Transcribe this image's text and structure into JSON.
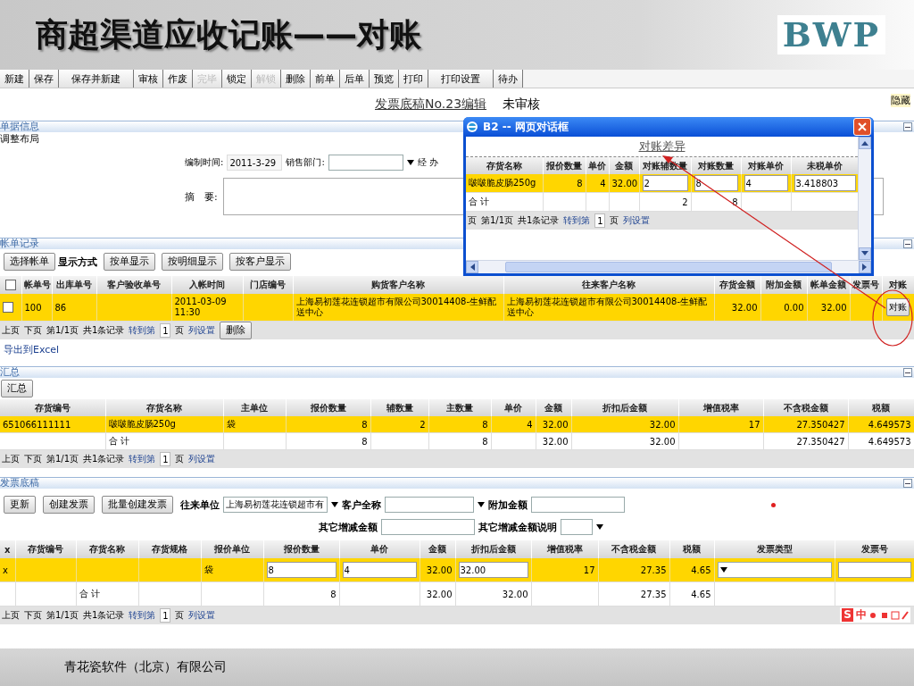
{
  "slide": {
    "title": "商超渠道应收记账——对账",
    "logo": "BWP",
    "footer": "青花瓷软件（北京）有限公司"
  },
  "toolbar": [
    {
      "label": "新建",
      "disabled": false
    },
    {
      "label": "保存",
      "disabled": false
    },
    {
      "label": "保存并新建",
      "disabled": false
    },
    {
      "label": "审核",
      "disabled": false
    },
    {
      "label": "作废",
      "disabled": false
    },
    {
      "label": "完毕",
      "disabled": true
    },
    {
      "label": "锁定",
      "disabled": false
    },
    {
      "label": "解锁",
      "disabled": true
    },
    {
      "label": "删除",
      "disabled": false
    },
    {
      "label": "前单",
      "disabled": false
    },
    {
      "label": "后单",
      "disabled": false
    },
    {
      "label": "预览",
      "disabled": false
    },
    {
      "label": "打印",
      "disabled": false
    },
    {
      "label": "打印设置",
      "disabled": false
    },
    {
      "label": "待办",
      "disabled": false
    }
  ],
  "document": {
    "title": "发票底稿No.23编辑",
    "status": "未审核",
    "hide_link": "隐藏"
  },
  "document_info": {
    "section_title": "单据信息",
    "layout_link": "调整布局",
    "date_label": "编制时间:",
    "date_value": "2011-3-29",
    "department_label": "销售部门:",
    "handler_label": "经 办",
    "summary_label": "摘　要:"
  },
  "bill_records": {
    "section_title": "帐单记录",
    "select_button": "选择帐单",
    "display_label": "显示方式",
    "display_buttons": [
      "按单显示",
      "按明细显示",
      "按客户显示"
    ],
    "table": {
      "columns": [
        {
          "kind": "checkbox",
          "checked": false
        },
        "帐单号",
        "出库单号",
        "客户验收单号",
        "入帐时间",
        "门店编号",
        "购货客户名称",
        "往来客户名称",
        "存货金额",
        "附加金额",
        "帐单金额",
        "发票号",
        "对账"
      ],
      "rows": [
        {
          "kind": "item",
          "cells": [
            {
              "kind": "checkbox",
              "checked": false
            },
            "100",
            "86",
            null,
            "2011-03-09 11:30",
            null,
            "上海易初莲花连锁超市有限公司30014408-生鲜配送中心",
            "上海易初莲花连锁超市有限公司30014408-生鲜配送中心",
            "32.00",
            "0.00",
            "32.00",
            null,
            {
              "kind": "button",
              "label": "对账"
            }
          ]
        }
      ]
    },
    "pager": {
      "prev": "上页",
      "next": "下页",
      "page": "第1/1页",
      "count": "共1条记录",
      "goto": "转到第",
      "page_input": "1",
      "unit": "页",
      "columns_link": "列设置"
    },
    "delete_button": "删除",
    "export_link": "导出到Excel"
  },
  "summary": {
    "section_title": "汇总",
    "summary_button": "汇总",
    "table": {
      "columns": [
        "存货编号",
        "存货名称",
        "主单位",
        "报价数量",
        "辅数量",
        "主数量",
        "单价",
        "金额",
        "折扣后金额",
        "增值税率",
        "不含税金额",
        "税额"
      ],
      "rows": [
        {
          "kind": "item",
          "cells": [
            "651066111111",
            "啵啵脆皮肠250g",
            "袋",
            "8",
            "2",
            "8",
            "4",
            "32.00",
            "32.00",
            "17",
            "27.350427",
            "4.649573"
          ]
        },
        {
          "kind": "total",
          "cells": [
            null,
            "合 计",
            null,
            "8",
            null,
            "8",
            null,
            "32.00",
            "32.00",
            null,
            "27.350427",
            "4.649573"
          ]
        }
      ]
    },
    "pager": {
      "prev": "上页",
      "next": "下页",
      "page": "第1/1页",
      "count": "共1条记录",
      "goto": "转到第",
      "page_input": "1",
      "unit": "页",
      "columns_link": "列设置"
    }
  },
  "invoice_draft": {
    "section_title": "发票底稿",
    "buttons": [
      "更新",
      "创建发票",
      "批量创建发票"
    ],
    "partner_label": "往来单位",
    "partner_value": "上海易初莲花连锁超市有",
    "customer_label": "客户全称",
    "extra_label": "附加金额",
    "other_label": "其它增减金额",
    "other_note_label": "其它增减金额说明",
    "table": {
      "columns": [
        "x",
        "存货编号",
        "存货名称",
        "存货规格",
        "报价单位",
        "报价数量",
        "单价",
        "金额",
        "折扣后金额",
        "增值税率",
        "不含税金额",
        "税额",
        "发票类型",
        "发票号"
      ],
      "rows": [
        {
          "kind": "item",
          "cells": [
            "x",
            null,
            null,
            null,
            "袋",
            {
              "kind": "input",
              "value": "8"
            },
            {
              "kind": "input",
              "value": "4"
            },
            "32.00",
            {
              "kind": "input",
              "value": "32.00"
            },
            "17",
            "27.35",
            "4.65",
            {
              "kind": "select"
            },
            {
              "kind": "input"
            }
          ]
        },
        {
          "kind": "total",
          "cells": [
            null,
            null,
            "合 计",
            null,
            null,
            "8",
            null,
            "32.00",
            "32.00",
            null,
            "27.35",
            "4.65",
            null,
            null
          ]
        }
      ]
    },
    "pager": {
      "prev": "上页",
      "next": "下页",
      "page": "第1/1页",
      "count": "共1条记录",
      "goto": "转到第",
      "page_input": "1",
      "unit": "页",
      "columns_link": "列设置"
    }
  },
  "ime_toolbar": {
    "logo": "S",
    "mode": "中"
  },
  "dialog": {
    "title": "B2 -- 网页对话框",
    "heading": "对账差异",
    "table": {
      "columns": [
        "存货名称",
        "报价数量",
        "单价",
        "金额",
        "对账辅数量",
        "对账数量",
        "对账单价",
        "未税单价"
      ],
      "rows": [
        {
          "kind": "item",
          "cells": [
            "啵啵脆皮肠250g",
            "8",
            "4",
            "32.00",
            {
              "kind": "input",
              "value": "2"
            },
            {
              "kind": "input",
              "value": "8"
            },
            {
              "kind": "input",
              "value": "4"
            },
            {
              "kind": "input",
              "value": "3.418803"
            }
          ]
        },
        {
          "kind": "total",
          "cells": [
            "合 计",
            null,
            null,
            null,
            "2",
            "8",
            null,
            null
          ]
        }
      ]
    },
    "pager": {
      "next": "页",
      "page": "第1/1页",
      "count": "共1条记录",
      "goto": "转到第",
      "page_input": "1",
      "unit": "页",
      "columns_link": "列设置"
    }
  }
}
